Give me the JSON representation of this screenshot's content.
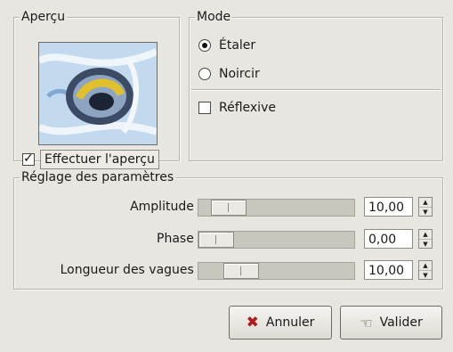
{
  "preview": {
    "title": "Aperçu",
    "check_label": "Effectuer l'aperçu",
    "checked": true
  },
  "mode": {
    "title": "Mode",
    "options": [
      {
        "label": "Étaler",
        "selected": true
      },
      {
        "label": "Noircir",
        "selected": false
      }
    ],
    "reflexive_label": "Réflexive",
    "reflexive_checked": false
  },
  "params": {
    "title": "Réglage des paramètres",
    "rows": [
      {
        "label": "Amplitude :",
        "value": "10,00"
      },
      {
        "label": "Phase :",
        "value": "0,00"
      },
      {
        "label": "Longueur des vagues :",
        "value": "10,00"
      }
    ]
  },
  "buttons": {
    "cancel": "Annuler",
    "ok": "Valider"
  },
  "icons": {
    "cancel": "close-icon",
    "ok": "hand-ok-icon"
  },
  "colors": {
    "background": "#e8e6e1",
    "cancel_icon": "#b01a1a"
  }
}
